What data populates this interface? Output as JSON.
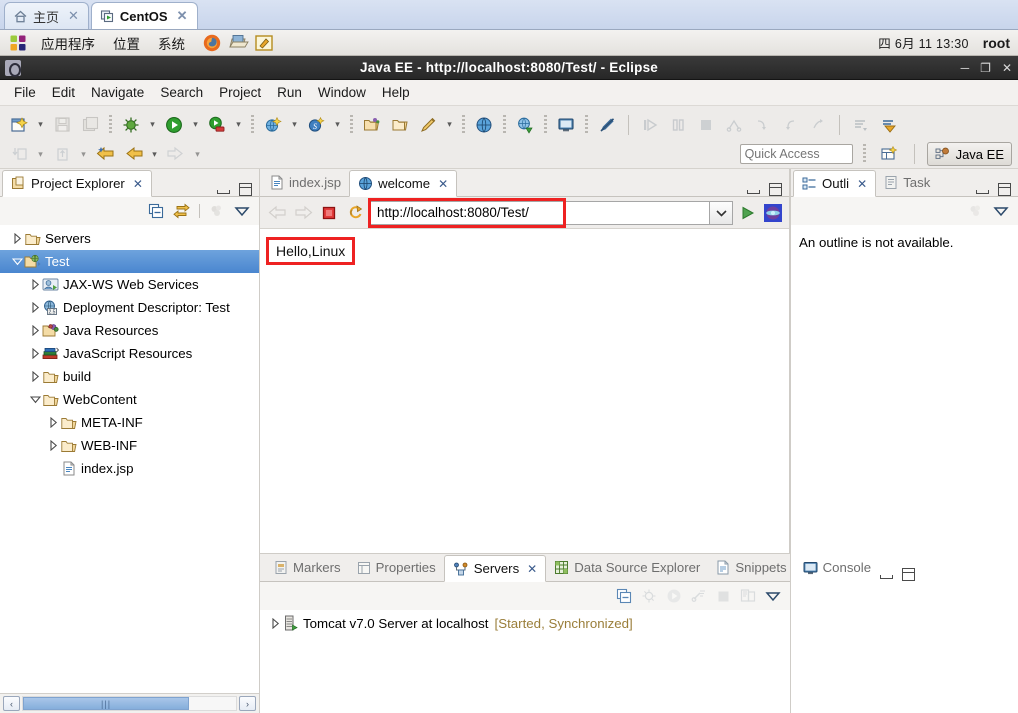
{
  "vm_tabs": [
    {
      "label": "主页",
      "icon": "home-icon",
      "active": false,
      "close": "✕"
    },
    {
      "label": "CentOS",
      "icon": "vm-icon",
      "active": true,
      "close": "✕"
    }
  ],
  "gnome_panel": {
    "menus": [
      "应用程序",
      "位置",
      "系统"
    ],
    "launchers": [
      "firefox-icon",
      "files-icon",
      "text-editor-icon"
    ],
    "clock": "四 6月 11 13:30",
    "user": "root"
  },
  "eclipse": {
    "title": "Java EE - http://localhost:8080/Test/ - Eclipse",
    "window_controls": {
      "minimize": "─",
      "maximize": "❐",
      "close": "✕"
    },
    "menus": [
      "File",
      "Edit",
      "Navigate",
      "Search",
      "Project",
      "Run",
      "Window",
      "Help"
    ],
    "toolbar": {
      "row1": [
        "new-wizard-icon",
        "dropdown-arrow",
        "save-icon",
        "save-all-icon",
        "separator",
        "debug-icon",
        "dropdown-arrow",
        "run-icon",
        "dropdown-arrow",
        "run-server-icon",
        "dropdown-arrow",
        "separator",
        "new-web-project-icon",
        "dropdown-arrow",
        "new-server-icon",
        "dropdown-arrow",
        "separator",
        "open-type-icon",
        "open-task-icon",
        "annotation-icon",
        "dropdown-arrow",
        "separator",
        "web-browser-icon",
        "separator",
        "open-web-browser-icon",
        "separator",
        "open-console-icon",
        "separator",
        "hide-annotations-icon",
        "separator",
        "step-into-icon",
        "step-over-icon",
        "terminate-icon",
        "step-return-icon",
        "resume-icon",
        "suspend-icon",
        "disconnect-icon",
        "separator",
        "next-annotation-icon",
        "previous-annotation-icon"
      ],
      "row2": [
        "save-build-icon",
        "dropdown-arrow",
        "publish-icon",
        "dropdown-arrow",
        "back-history-icon",
        "forward-history-icon",
        "dropdown-arrow",
        "next-edit-icon",
        "dropdown-arrow"
      ]
    },
    "quick_access_placeholder": "Quick Access",
    "open-perspective-icon": "open-perspective-icon",
    "perspective": {
      "label": "Java EE",
      "icon": "java-ee-icon"
    }
  },
  "project_explorer": {
    "tab_label": "Project Explorer",
    "tab_icon": "project-explorer-icon",
    "tab_close": "✕",
    "controls": {
      "minimize": "minimize-icon",
      "maximize": "maximize-icon"
    },
    "toolbar": [
      "collapse-all-icon",
      "link-with-editor-icon",
      "separator",
      "focus-icon",
      "view-menu-icon"
    ],
    "tree": [
      {
        "label": "Servers",
        "depth": 0,
        "twisty": "closed",
        "icon": "folder-icon",
        "selected": false
      },
      {
        "label": "Test",
        "depth": 0,
        "twisty": "open",
        "icon": "web-project-icon",
        "selected": true
      },
      {
        "label": "JAX-WS Web Services",
        "depth": 1,
        "twisty": "closed",
        "icon": "jaxws-icon",
        "selected": false
      },
      {
        "label": "Deployment Descriptor: Test",
        "depth": 1,
        "twisty": "closed",
        "icon": "deployment-descriptor-icon",
        "selected": false
      },
      {
        "label": "Java Resources",
        "depth": 1,
        "twisty": "closed",
        "icon": "java-resources-icon",
        "selected": false
      },
      {
        "label": "JavaScript Resources",
        "depth": 1,
        "twisty": "closed",
        "icon": "javascript-resources-icon",
        "selected": false
      },
      {
        "label": "build",
        "depth": 1,
        "twisty": "closed",
        "icon": "folder-icon",
        "selected": false
      },
      {
        "label": "WebContent",
        "depth": 1,
        "twisty": "open",
        "icon": "folder-icon",
        "selected": false
      },
      {
        "label": "META-INF",
        "depth": 2,
        "twisty": "closed",
        "icon": "folder-icon",
        "selected": false
      },
      {
        "label": "WEB-INF",
        "depth": 2,
        "twisty": "closed",
        "icon": "folder-icon",
        "selected": false
      },
      {
        "label": "index.jsp",
        "depth": 2,
        "twisty": "none",
        "icon": "jsp-file-icon",
        "selected": false
      }
    ],
    "hscroll": {
      "left_arrow": "‹",
      "right_arrow": "›",
      "thumb_grip": "|||"
    }
  },
  "editor": {
    "tabs": [
      {
        "label": "index.jsp",
        "icon": "jsp-file-icon",
        "active": false,
        "close": ""
      },
      {
        "label": "welcome",
        "icon": "web-browser-icon",
        "active": true,
        "close": "✕"
      }
    ],
    "controls": {
      "minimize": "minimize-icon",
      "maximize": "maximize-icon"
    },
    "browser": {
      "back_icon": "back-arrow-icon",
      "forward_icon": "forward-arrow-icon",
      "stop_icon": "stop-icon",
      "refresh_icon": "refresh-icon",
      "url": "http://localhost:8080/Test/",
      "dropdown_icon": "chevron-down-icon",
      "go_icon": "go-icon",
      "home_icon": "browser-home-icon",
      "page_content": "Hello,Linux",
      "highlight_color": "#ee2222"
    }
  },
  "outline": {
    "tabs": [
      {
        "label": "Outli",
        "icon": "outline-icon",
        "active": true,
        "close": "✕"
      },
      {
        "label": "Task",
        "icon": "task-list-icon",
        "active": false,
        "close": ""
      }
    ],
    "controls": {
      "minimize": "minimize-icon",
      "maximize": "maximize-icon"
    },
    "toolbar": [
      "focus-icon",
      "view-menu-icon"
    ],
    "message": "An outline is not available."
  },
  "bottom_panel": {
    "tabs": [
      {
        "label": "Markers",
        "icon": "markers-icon",
        "active": false,
        "close": ""
      },
      {
        "label": "Properties",
        "icon": "properties-icon",
        "active": false,
        "close": ""
      },
      {
        "label": "Servers",
        "icon": "servers-icon",
        "active": true,
        "close": "✕"
      },
      {
        "label": "Data Source Explorer",
        "icon": "data-source-icon",
        "active": false,
        "close": ""
      },
      {
        "label": "Snippets",
        "icon": "snippets-icon",
        "active": false,
        "close": ""
      },
      {
        "label": "Console",
        "icon": "console-icon",
        "active": false,
        "close": ""
      }
    ],
    "controls": {
      "minimize": "minimize-icon",
      "maximize": "maximize-icon"
    },
    "toolbar": [
      "collapse-all-icon",
      "debug-server-icon",
      "start-server-icon",
      "profile-server-icon",
      "stop-server-icon",
      "publish-icon",
      "view-menu-icon"
    ],
    "servers": [
      {
        "twisty": "closed",
        "icon": "tomcat-server-icon",
        "name": "Tomcat v7.0 Server at localhost",
        "state": "[Started, Synchronized]"
      }
    ]
  }
}
